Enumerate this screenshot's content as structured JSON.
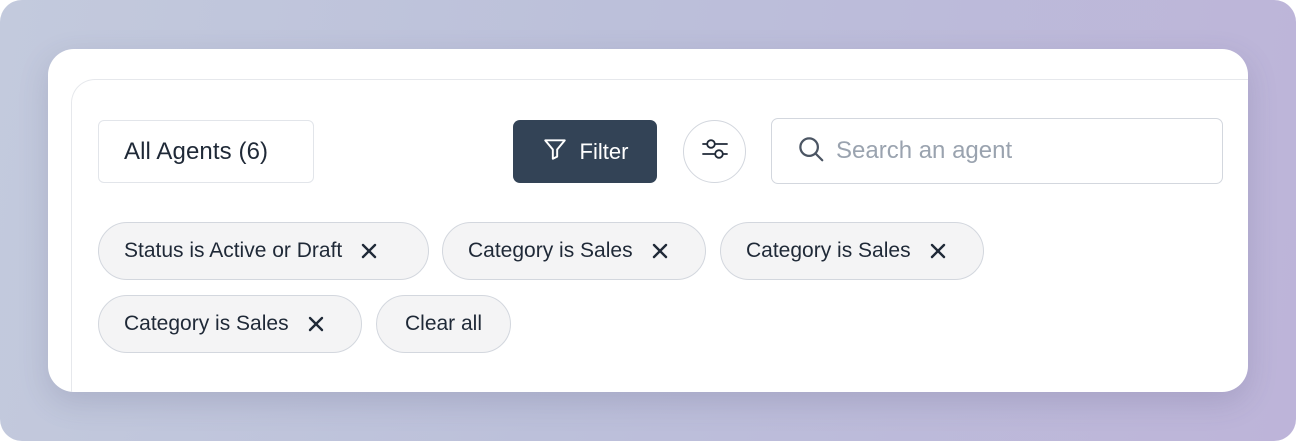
{
  "header": {
    "agents_label": "All Agents (6)",
    "filter_label": "Filter",
    "filter_icon": "funnel-icon",
    "settings_icon": "sliders-icon"
  },
  "search": {
    "placeholder": "Search an agent",
    "value": "",
    "icon": "search-icon"
  },
  "filters": [
    {
      "label": "Status is Active or Draft"
    },
    {
      "label": "Category is Sales"
    },
    {
      "label": "Category is Sales"
    },
    {
      "label": "Category is Sales"
    }
  ],
  "clear_all_label": "Clear all",
  "colors": {
    "primary_button": "#334356",
    "chip_background": "#f4f4f5",
    "text": "#1f2937",
    "placeholder": "#9aa3af"
  }
}
